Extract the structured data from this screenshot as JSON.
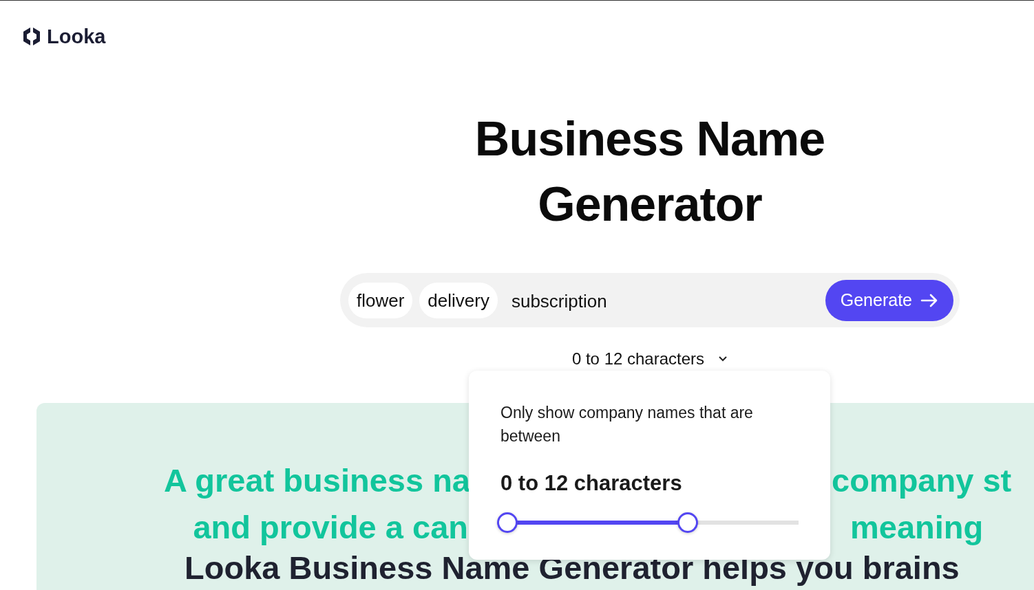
{
  "logo": {
    "name": "Looka"
  },
  "title": "Business Name Generator",
  "search": {
    "chips": [
      "flower",
      "delivery"
    ],
    "value": "subscription",
    "button": "Generate"
  },
  "length_dropdown": {
    "label": "0 to 12 characters",
    "expanded": true
  },
  "length_popover": {
    "text": "Only show company names that are between",
    "reading": "0 to 12 characters",
    "slider": {
      "thumbs": [
        {
          "level": 0
        },
        {
          "level": 0.62
        }
      ]
    }
  },
  "intro": {
    "lines": [
      {
        "kind": "split",
        "left": "A great business na",
        "right": "company st"
      },
      {
        "kind": "split",
        "left": "and provide a can",
        "right": "meaning"
      },
      {
        "kind": "plain",
        "text": "Looka Business Name Generator helps you brains"
      }
    ]
  }
}
